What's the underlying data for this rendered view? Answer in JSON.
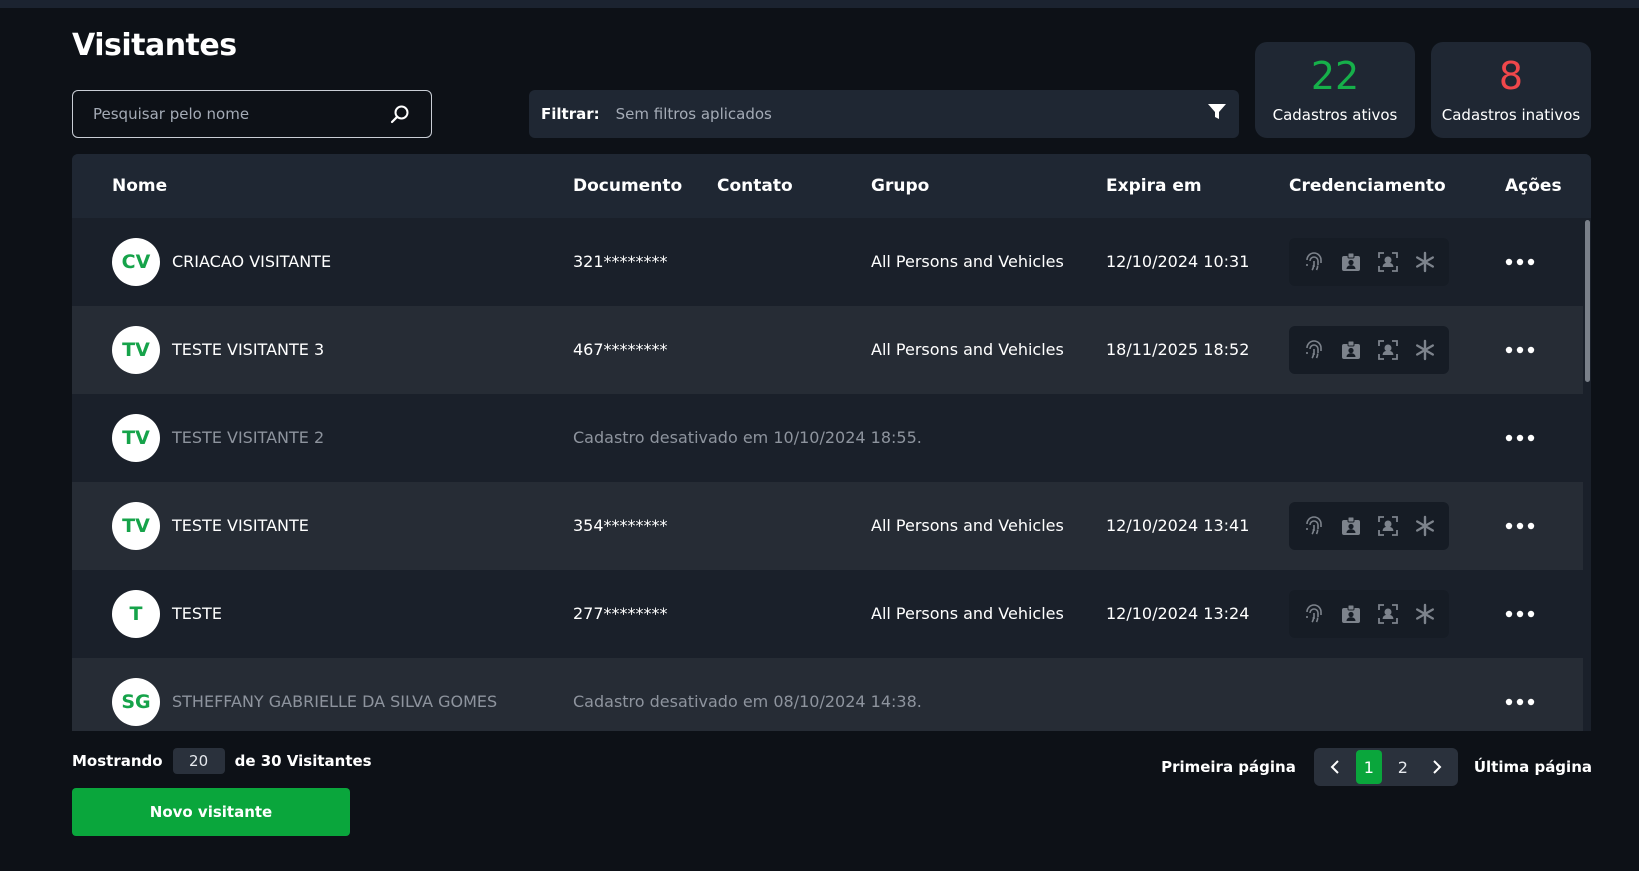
{
  "title": "Visitantes",
  "search": {
    "placeholder": "Pesquisar pelo nome",
    "icon": "search-icon"
  },
  "filter": {
    "label": "Filtrar:",
    "value": "Sem filtros aplicados",
    "icon": "funnel-icon"
  },
  "stats": {
    "active": {
      "value": "22",
      "label": "Cadastros ativos",
      "color": "#16b04a"
    },
    "inactive": {
      "value": "8",
      "label": "Cadastros inativos",
      "color": "#f0474b"
    }
  },
  "table": {
    "columns": {
      "nome": "Nome",
      "documento": "Documento",
      "contato": "Contato",
      "grupo": "Grupo",
      "expira": "Expira em",
      "credenciamento": "Credenciamento",
      "acoes": "Ações"
    },
    "rows": [
      {
        "initials": "CV",
        "name": "CRIACAO VISITANTE",
        "active": true,
        "document": "321********",
        "contact": "",
        "group": "All Persons and Vehicles",
        "expires": "12/10/2024 10:31",
        "note": ""
      },
      {
        "initials": "TV",
        "name": "TESTE VISITANTE 3",
        "active": true,
        "document": "467********",
        "contact": "",
        "group": "All Persons and Vehicles",
        "expires": "18/11/2025 18:52",
        "note": ""
      },
      {
        "initials": "TV",
        "name": "TESTE VISITANTE 2",
        "active": false,
        "document": "",
        "contact": "",
        "group": "",
        "expires": "",
        "note": "Cadastro desativado em 10/10/2024 18:55."
      },
      {
        "initials": "TV",
        "name": "TESTE VISITANTE",
        "active": true,
        "document": "354********",
        "contact": "",
        "group": "All Persons and Vehicles",
        "expires": "12/10/2024 13:41",
        "note": ""
      },
      {
        "initials": "T",
        "name": "TESTE",
        "active": true,
        "document": "277********",
        "contact": "",
        "group": "All Persons and Vehicles",
        "expires": "12/10/2024 13:24",
        "note": ""
      },
      {
        "initials": "SG",
        "name": "STHEFFANY GABRIELLE DA SILVA GOMES",
        "active": false,
        "document": "",
        "contact": "",
        "group": "",
        "expires": "",
        "note": "Cadastro desativado em 08/10/2024 14:38."
      }
    ],
    "credential_icons": [
      "fingerprint-icon",
      "id-card-icon",
      "face-scan-icon",
      "asterisk-icon"
    ],
    "actions_icon": "more-horizontal-icon"
  },
  "footer": {
    "showing_prefix": "Mostrando",
    "page_size": "20",
    "showing_suffix": "de 30 Visitantes",
    "new_button": "Novo visitante"
  },
  "pagination": {
    "first": "Primeira página",
    "last": "Última página",
    "pages": [
      "1",
      "2"
    ],
    "current": "1"
  }
}
